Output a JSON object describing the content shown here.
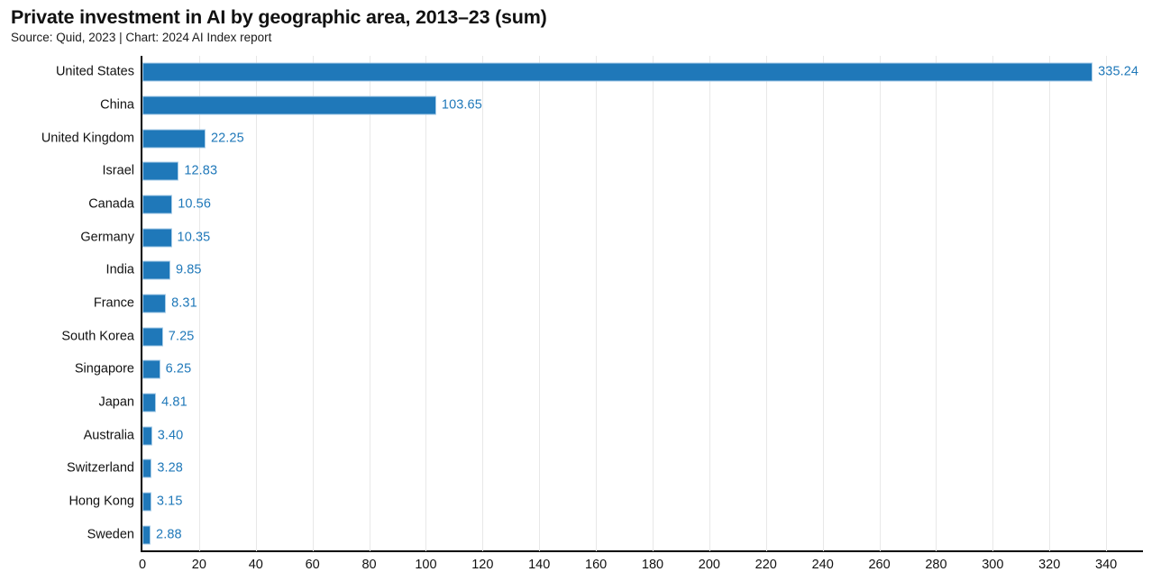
{
  "header": {
    "title": "Private investment in AI by geographic area, 2013–23 (sum)",
    "subtitle": "Source: Quid, 2023 | Chart: 2024 AI Index report"
  },
  "style": {
    "bar_color": "#1f78b9",
    "bar_edge_color": "#a9cde8",
    "value_label_color": "#1f78b9",
    "gridline_color": "#e8e8e8",
    "axis_color": "#000000",
    "background": "#ffffff"
  },
  "chart_data": {
    "type": "bar",
    "orientation": "horizontal",
    "title": "Private investment in AI by geographic area, 2013–23 (sum)",
    "subtitle": "Source: Quid, 2023 | Chart: 2024 AI Index report",
    "xlabel": "",
    "ylabel": "",
    "xlim": [
      0,
      353
    ],
    "xticks": [
      0,
      20,
      40,
      60,
      80,
      100,
      120,
      140,
      160,
      180,
      200,
      220,
      240,
      260,
      280,
      300,
      320,
      340
    ],
    "xtick_labels": [
      "0",
      "20",
      "40",
      "60",
      "80",
      "100",
      "120",
      "140",
      "160",
      "180",
      "200",
      "220",
      "240",
      "260",
      "280",
      "300",
      "320",
      "340"
    ],
    "grid": true,
    "grid_axis": "x",
    "legend": false,
    "categories": [
      "United States",
      "China",
      "United Kingdom",
      "Israel",
      "Canada",
      "Germany",
      "India",
      "France",
      "South Korea",
      "Singapore",
      "Japan",
      "Australia",
      "Switzerland",
      "Hong Kong",
      "Sweden"
    ],
    "values": [
      335.24,
      103.65,
      22.25,
      12.83,
      10.56,
      10.35,
      9.85,
      8.31,
      7.25,
      6.25,
      4.81,
      3.4,
      3.28,
      3.15,
      2.88
    ],
    "value_labels": [
      "335.24",
      "103.65",
      "22.25",
      "12.83",
      "10.56",
      "10.35",
      "9.85",
      "8.31",
      "7.25",
      "6.25",
      "4.81",
      "3.40",
      "3.28",
      "3.15",
      "2.88"
    ]
  }
}
